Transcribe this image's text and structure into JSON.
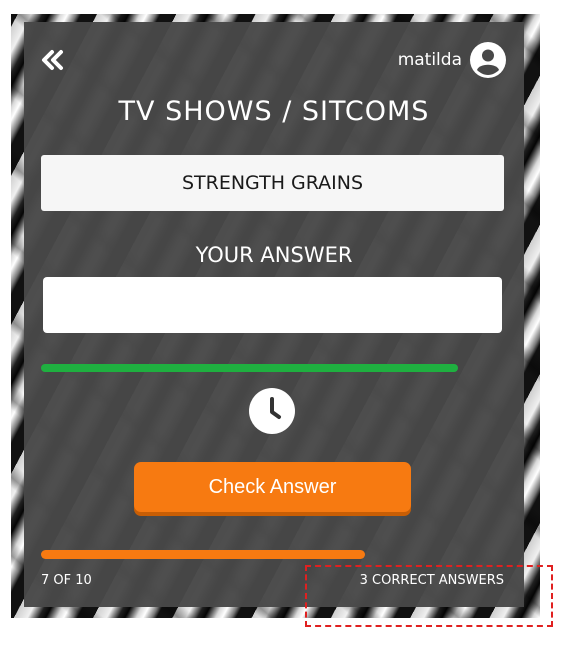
{
  "user": {
    "name": "matilda",
    "avatar_icon": "user-circle-icon"
  },
  "navigation": {
    "back_icon": "double-chevron-left-icon"
  },
  "quiz": {
    "category": "TV SHOWS / SITCOMS",
    "clue": "STRENGTH GRAINS",
    "answer_label": "YOUR ANSWER",
    "answer_value": "",
    "answer_placeholder": "",
    "timer_icon": "clock-icon",
    "timer_remaining_fraction": 0.9,
    "check_button_label": "Check Answer"
  },
  "progress": {
    "current": 7,
    "total": 10,
    "question_count_text": "7 OF 10",
    "correct_answers_text": "3 CORRECT ANSWERS"
  },
  "colors": {
    "card_bg": "#484848",
    "accent_orange": "#f77a11",
    "timer_green": "#1fb040",
    "highlight_red": "#e02020"
  }
}
